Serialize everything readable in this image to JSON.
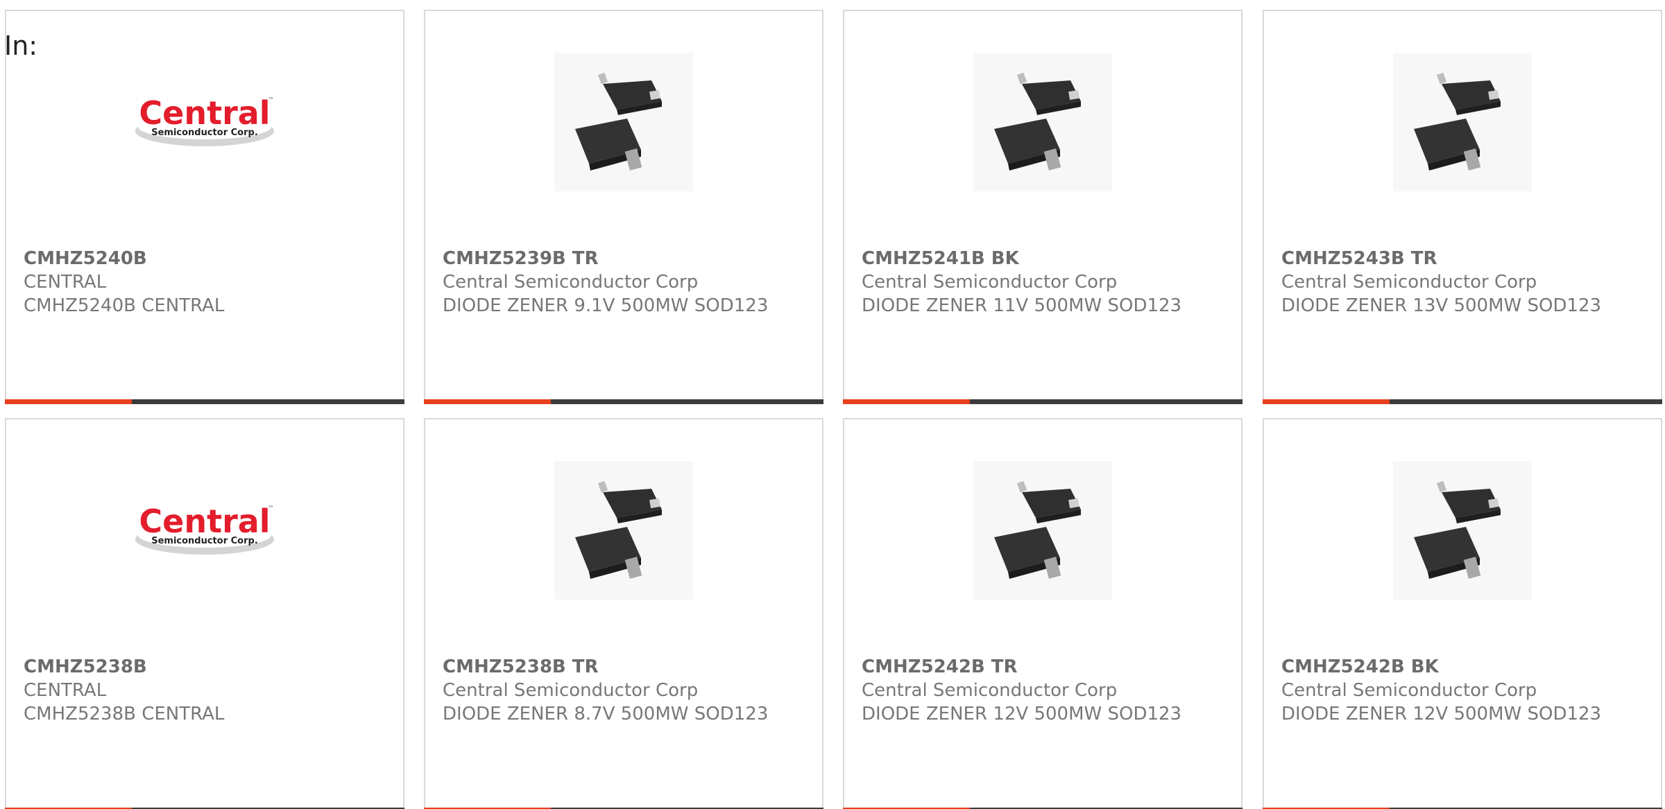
{
  "header": {
    "in_label": "In:"
  },
  "products": [
    {
      "part": "CMHZ5240B",
      "manufacturer": "CENTRAL",
      "description": "CMHZ5240B CENTRAL",
      "image": "central-logo"
    },
    {
      "part": "CMHZ5239B TR",
      "manufacturer": "Central Semiconductor Corp",
      "description": "DIODE ZENER 9.1V 500MW SOD123",
      "image": "sod123-package"
    },
    {
      "part": "CMHZ5241B BK",
      "manufacturer": "Central Semiconductor Corp",
      "description": "DIODE ZENER 11V 500MW SOD123",
      "image": "sod123-package"
    },
    {
      "part": "CMHZ5243B TR",
      "manufacturer": "Central Semiconductor Corp",
      "description": "DIODE ZENER 13V 500MW SOD123",
      "image": "sod123-package"
    },
    {
      "part": "CMHZ5238B",
      "manufacturer": "CENTRAL",
      "description": "CMHZ5238B CENTRAL",
      "image": "central-logo"
    },
    {
      "part": "CMHZ5238B TR",
      "manufacturer": "Central Semiconductor Corp",
      "description": "DIODE ZENER 8.7V 500MW SOD123",
      "image": "sod123-package"
    },
    {
      "part": "CMHZ5242B TR",
      "manufacturer": "Central Semiconductor Corp",
      "description": "DIODE ZENER 12V 500MW SOD123",
      "image": "sod123-package"
    },
    {
      "part": "CMHZ5242B BK",
      "manufacturer": "Central Semiconductor Corp",
      "description": "DIODE ZENER 12V 500MW SOD123",
      "image": "sod123-package"
    }
  ],
  "logo": {
    "brand": "Central",
    "tm": "™",
    "sub": "Semiconductor Corp."
  },
  "colors": {
    "accent": "#e8401c",
    "bar": "#3c3c3c",
    "logo_red": "#e31d2c",
    "text": "#777777"
  }
}
